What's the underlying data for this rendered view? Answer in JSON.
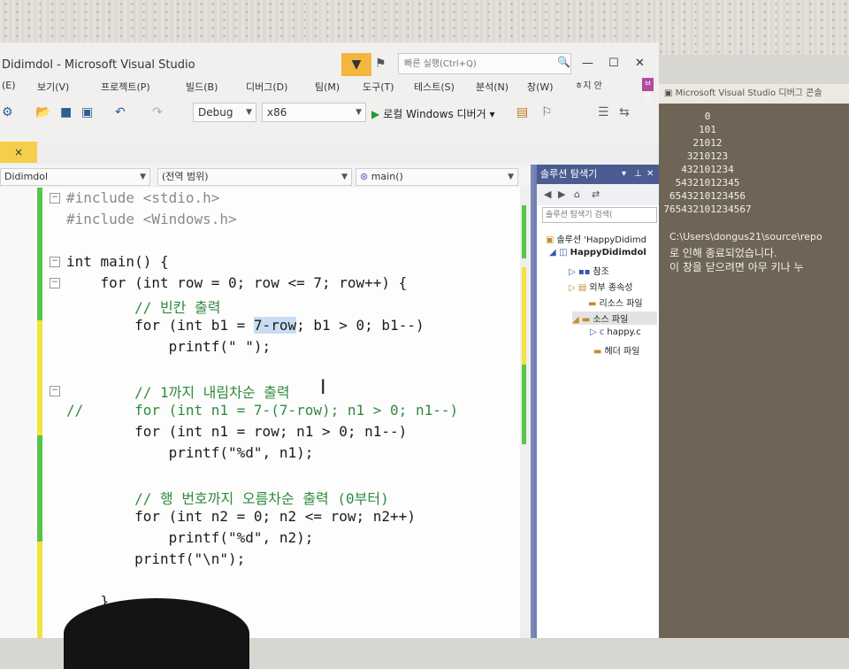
{
  "window": {
    "title": "Didimdol - Microsoft Visual Studio",
    "quick_launch_placeholder": "빠른 실행(Ctrl+Q)",
    "account_name": "ㅎ지 안",
    "account_initial": "ㅂ안"
  },
  "menu": [
    "(E)",
    "보기(V)",
    "프로젝트(P)",
    "빌드(B)",
    "디버그(D)",
    "팀(M)",
    "도구(T)",
    "테스트(S)",
    "분석(N)",
    "창(W)"
  ],
  "toolbar": {
    "config": "Debug",
    "platform": "x86",
    "run_label": "로컬 Windows 디버거"
  },
  "tabs": {
    "active_doc": "×"
  },
  "editor": {
    "scope_left": "Didimdol",
    "scope_middle": "(전역 범위)",
    "scope_right": "main()",
    "lines": {
      "l1": "#include <stdio.h>",
      "l2": "#include <Windows.h>",
      "l3": "int main() {",
      "l4": "    for (int row = 0; row <= 7; row++) {",
      "l5": "        // 빈칸 출력",
      "l6a": "        for (int b1 = ",
      "l6b": "7-row",
      "l6c": "; b1 > 0; b1--)",
      "l7": "            printf(\" \");",
      "l8": "        // 1까지 내림차순 출력",
      "l9": "//      for (int n1 = 7-(7-row); n1 > 0; n1--)",
      "l10": "        for (int n1 = row; n1 > 0; n1--)",
      "l11": "            printf(\"%d\", n1);",
      "l12": "        // 행 번호까지 오름차순 출력 (0부터)",
      "l13": "        for (int n2 = 0; n2 <= row; n2++)",
      "l14": "            printf(\"%d\", n2);",
      "l15": "        printf(\"\\n\");",
      "l16": "    }"
    }
  },
  "solution_explorer": {
    "title": "솔루션 탐색기",
    "search_placeholder": "솔루션 탐색기 검색(",
    "nodes": [
      "솔루션 'HappyDidimd",
      "HappyDidimdol",
      "참조",
      "외부 종속성",
      "리소스 파일",
      "소스 파일",
      "happy.c",
      "헤더 파일"
    ]
  },
  "console": {
    "title": "Microsoft Visual Studio 디버그 콘솔",
    "output": [
      "0",
      "101",
      "21012",
      "3210123",
      "432101234",
      "54321012345",
      "6543210123456",
      "765432101234567"
    ],
    "path_line": "C:\\Users\\dongus21\\source\\repo",
    "exit_line": "로 인해 종료되었습니다.",
    "close_line": "이 창을 닫으려면 아무 키나 누"
  }
}
